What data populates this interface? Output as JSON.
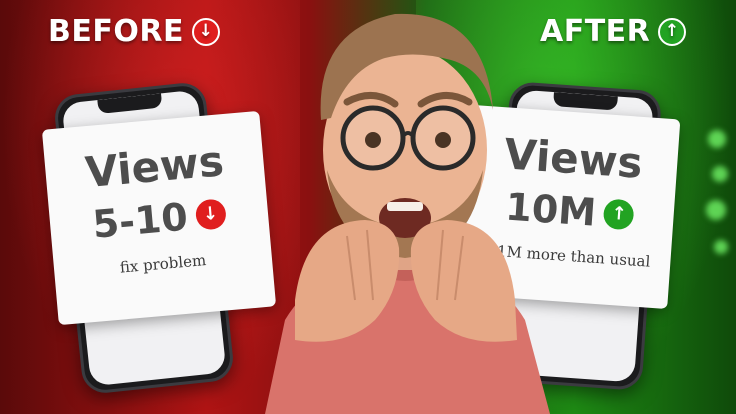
{
  "labels": {
    "before": "BEFORE",
    "after": "AFTER"
  },
  "cards": {
    "left": {
      "title": "Views",
      "count": "5-10",
      "note": "fix problem",
      "trend": "down"
    },
    "right": {
      "title": "Views",
      "count": "10M",
      "note": "1.1M more than usual",
      "trend": "up"
    }
  },
  "icons": {
    "down": "↓",
    "up": "↑"
  },
  "colors": {
    "down_badge": "#e01e1e",
    "up_badge": "#22a322",
    "left_background": "#b01414",
    "right_background": "#1e8a14"
  }
}
